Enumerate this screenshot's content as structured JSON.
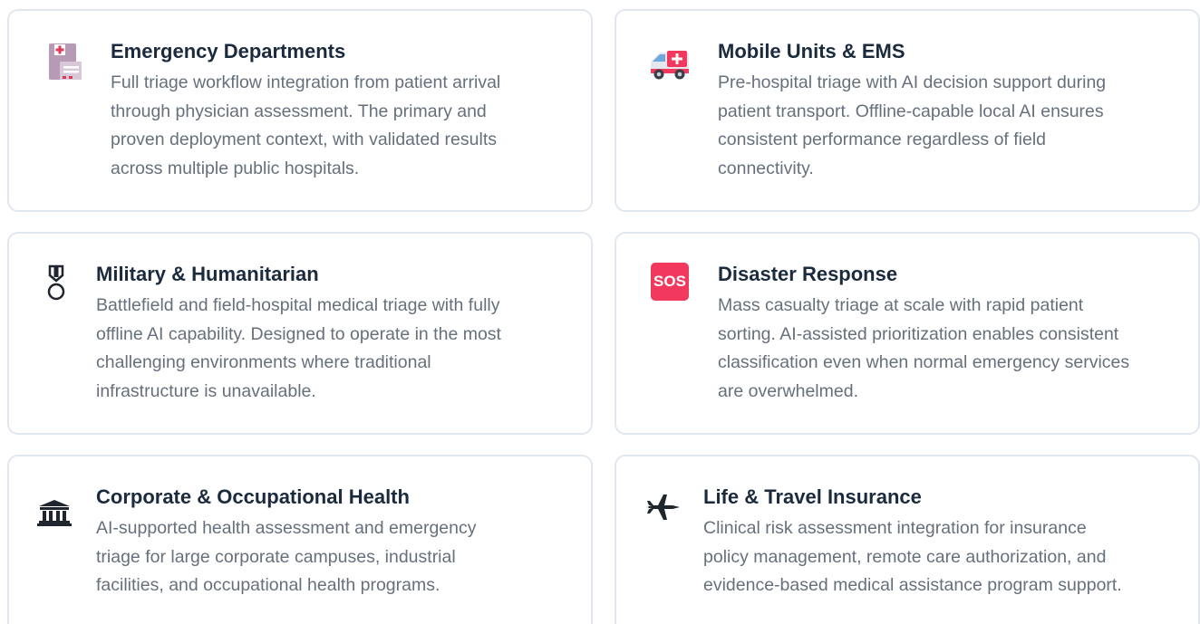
{
  "cards": [
    {
      "icon": "hospital-icon",
      "title": "Emergency Departments",
      "lines": [
        "Full triage workflow integration from patient arrival",
        "through physician assessment. The primary and",
        "proven deployment context, with validated results",
        "across multiple public hospitals."
      ]
    },
    {
      "icon": "ambulance-icon",
      "title": "Mobile Units & EMS",
      "lines": [
        "Pre-hospital triage with AI decision support during",
        "patient transport. Offline-capable local AI ensures",
        "consistent performance regardless of field",
        "connectivity."
      ]
    },
    {
      "icon": "military-medal-icon",
      "title": "Military & Humanitarian",
      "lines": [
        "Battlefield and field-hospital medical triage with fully",
        "offline AI capability. Designed to operate in the most",
        "challenging environments where traditional",
        "infrastructure is unavailable."
      ]
    },
    {
      "icon": "sos-icon",
      "icon_text": "SOS",
      "title": "Disaster Response",
      "lines": [
        "Mass casualty triage at scale with rapid patient",
        "sorting. AI-assisted prioritization enables consistent",
        "classification even when normal emergency services",
        "are overwhelmed."
      ]
    },
    {
      "icon": "classical-building-icon",
      "title": "Corporate & Occupational Health",
      "lines": [
        "AI-supported health assessment and emergency",
        "triage for large corporate campuses, industrial",
        "facilities, and occupational health programs."
      ]
    },
    {
      "icon": "airplane-icon",
      "title": "Life & Travel Insurance",
      "lines": [
        "Clinical risk assessment integration for insurance",
        "policy management, remote care authorization, and",
        "evidence-based medical assistance program support."
      ]
    }
  ],
  "colors": {
    "title": "#1b2a3d",
    "description": "#66707c",
    "border": "#e1e7ee",
    "sos": "#f2395d"
  }
}
